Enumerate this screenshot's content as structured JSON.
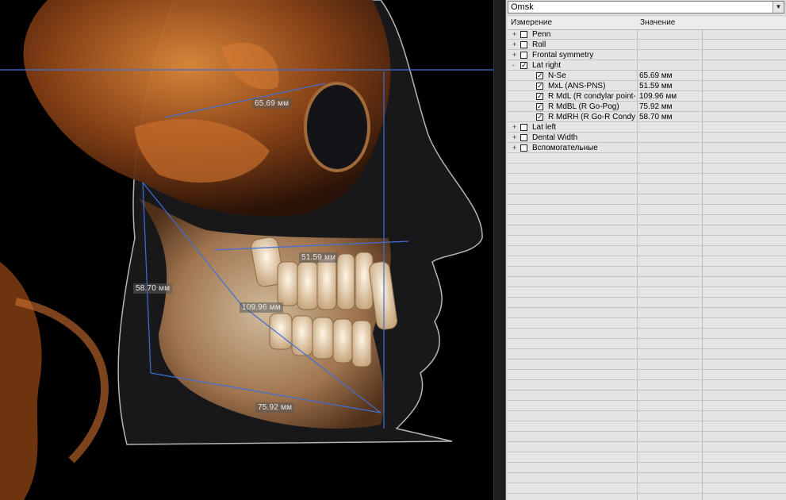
{
  "viewport": {
    "labels": [
      "65.69 мм",
      "51.59 мм",
      "58.70 мм",
      "109.96 мм",
      "75.92 мм"
    ]
  },
  "panel": {
    "preset": "Omsk",
    "columns": {
      "measure": "Измерение",
      "value": "Значение"
    },
    "rows": [
      {
        "label": "Penn",
        "level": 0,
        "expander": "+",
        "checked": false,
        "value": ""
      },
      {
        "label": "Roll",
        "level": 0,
        "expander": "+",
        "checked": false,
        "value": ""
      },
      {
        "label": "Frontal symmetry",
        "level": 0,
        "expander": "+",
        "checked": false,
        "value": ""
      },
      {
        "label": "Lat right",
        "level": 0,
        "expander": "-",
        "checked": true,
        "value": ""
      },
      {
        "label": "N-Se",
        "level": 1,
        "expander": "",
        "checked": true,
        "value": "65.69 мм"
      },
      {
        "label": "MxL (ANS-PNS)",
        "level": 1,
        "expander": "",
        "checked": true,
        "value": "51.59 мм"
      },
      {
        "label": "R MdL (R condylar point-Pc",
        "level": 1,
        "expander": "",
        "checked": true,
        "value": "109.96 мм"
      },
      {
        "label": "R MdBL (R Go-Pog)",
        "level": 1,
        "expander": "",
        "checked": true,
        "value": "75.92 мм"
      },
      {
        "label": "R MdRH (R Go-R Condylar",
        "level": 1,
        "expander": "",
        "checked": true,
        "value": "58.70 мм"
      },
      {
        "label": "Lat left",
        "level": 0,
        "expander": "+",
        "checked": false,
        "value": ""
      },
      {
        "label": "Dental Width",
        "level": 0,
        "expander": "+",
        "checked": false,
        "value": ""
      },
      {
        "label": "Вспомогательные",
        "level": 0,
        "expander": "+",
        "checked": false,
        "value": ""
      }
    ]
  }
}
